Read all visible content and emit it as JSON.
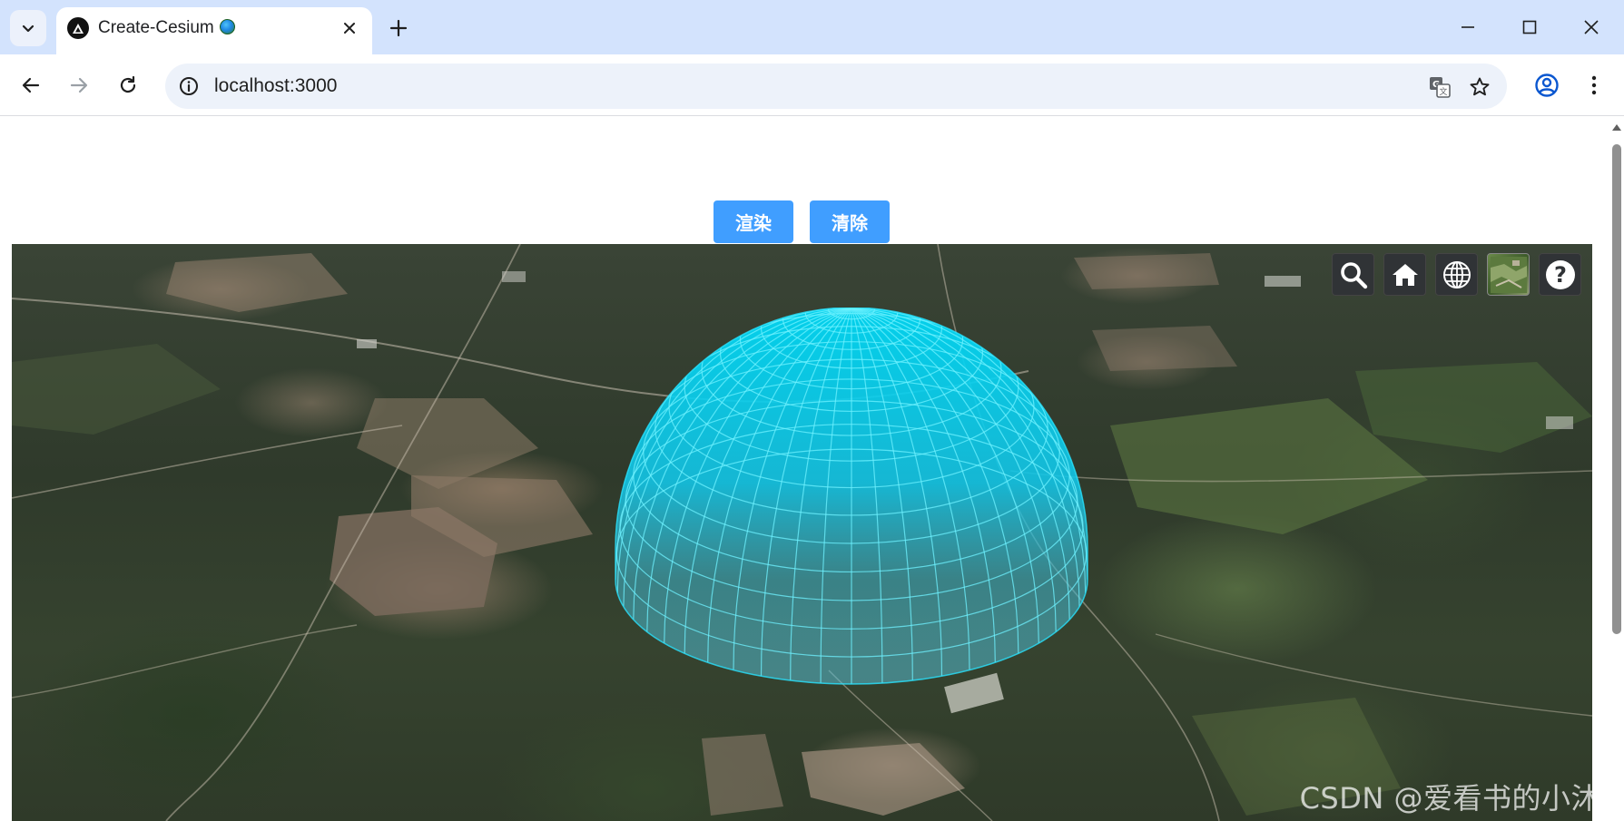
{
  "browser": {
    "tab": {
      "title": "Create-Cesium"
    },
    "address": {
      "url": "localhost:3000"
    }
  },
  "page": {
    "buttons": {
      "render_label": "渲染",
      "clear_label": "清除"
    }
  },
  "viewer": {
    "toolbar_icons": [
      "search-icon",
      "home-icon",
      "globe-icon",
      "imagery-layer-icon",
      "help-icon"
    ],
    "dome_color": "#00d8f5",
    "watermark": "CSDN @爱看书的小沐"
  },
  "colors": {
    "titlebar": "#d3e3fd",
    "button_primary": "#409eff"
  }
}
